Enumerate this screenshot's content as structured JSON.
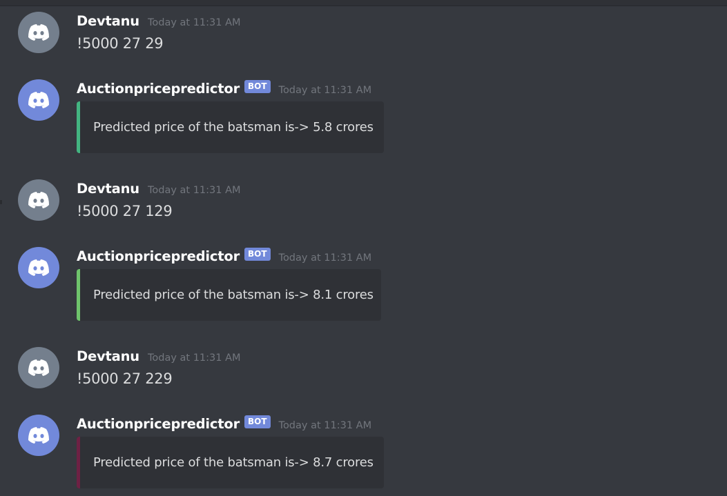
{
  "colors": {
    "background": "#36393f",
    "user_avatar": "#747f8d",
    "bot_avatar": "#7289da",
    "bot_badge": "#7289da",
    "embed_background": "#2f3136"
  },
  "messages": [
    {
      "type": "user",
      "avatar_icon": "discord-logo-icon",
      "username": "Devtanu",
      "timestamp": "Today at 11:31 AM",
      "content": "!5000 27 29"
    },
    {
      "type": "bot",
      "avatar_icon": "discord-logo-icon",
      "username": "Auctionpricepredictor",
      "badge": "BOT",
      "timestamp": "Today at 11:31 AM",
      "embed": {
        "text": "Predicted price of the batsman is-> 5.8 crores",
        "bar_color": "#43b581"
      }
    },
    {
      "type": "user",
      "avatar_icon": "discord-logo-icon",
      "username": "Devtanu",
      "timestamp": "Today at 11:31 AM",
      "content": "!5000 27 129"
    },
    {
      "type": "bot",
      "avatar_icon": "discord-logo-icon",
      "username": "Auctionpricepredictor",
      "badge": "BOT",
      "timestamp": "Today at 11:31 AM",
      "embed": {
        "text": "Predicted price of the batsman is-> 8.1 crores",
        "bar_color": "#6fc46c"
      }
    },
    {
      "type": "user",
      "avatar_icon": "discord-logo-icon",
      "username": "Devtanu",
      "timestamp": "Today at 11:31 AM",
      "content": "!5000 27 229"
    },
    {
      "type": "bot",
      "avatar_icon": "discord-logo-icon",
      "username": "Auctionpricepredictor",
      "badge": "BOT",
      "timestamp": "Today at 11:31 AM",
      "embed": {
        "text": "Predicted price of the batsman is-> 8.7 crores",
        "bar_color": "#6e2144"
      }
    }
  ]
}
